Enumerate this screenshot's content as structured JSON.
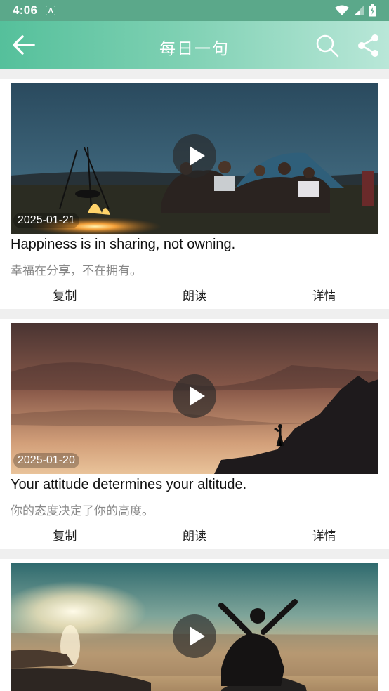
{
  "status_bar": {
    "time": "4:06",
    "a_badge": "A"
  },
  "app_bar": {
    "title": "每日一句"
  },
  "cards": [
    {
      "date": "2025-01-21",
      "english": "Happiness is in sharing, not owning.",
      "chinese": "幸福在分享，不在拥有。",
      "actions": {
        "copy": "复制",
        "read": "朗读",
        "detail": "详情"
      }
    },
    {
      "date": "2025-01-20",
      "english": "Your attitude determines your altitude.",
      "chinese": "你的态度决定了你的高度。",
      "actions": {
        "copy": "复制",
        "read": "朗读",
        "detail": "详情"
      }
    },
    {
      "date": "",
      "english": "",
      "chinese": ""
    }
  ],
  "colors": {
    "accent": "#55c09b",
    "status_bar": "#5ba88a",
    "background": "#efefef"
  }
}
